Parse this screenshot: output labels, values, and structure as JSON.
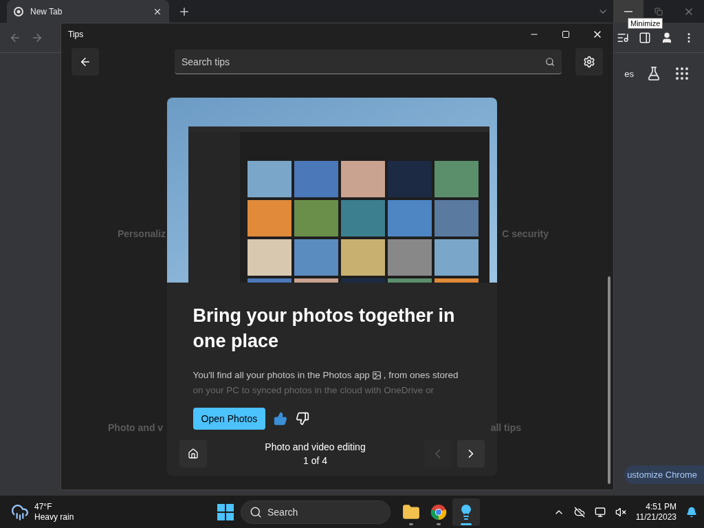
{
  "browser": {
    "tab": {
      "title": "New Tab",
      "selected": true
    },
    "tooltip": "Minimize",
    "toolbar_label": "es",
    "customize_button": "ustomize Chrome"
  },
  "tips": {
    "title": "Tips",
    "search": {
      "placeholder": "Search tips"
    },
    "background_tiles": [
      {
        "label": "Personaliz"
      },
      {
        "label": "C security"
      },
      {
        "label": "Photo and v"
      },
      {
        "label": "all tips"
      }
    ],
    "card": {
      "heading": "Bring your photos together in one place",
      "body_before_icon": "You'll find all your photos in the Photos app",
      "body_after_icon": ", from ones stored",
      "body_faded": "on your PC to synced photos in the cloud with OneDrive or",
      "action": "Open Photos",
      "liked": true,
      "disliked": false
    },
    "footer": {
      "category": "Photo and video editing",
      "position": "1 of 4",
      "prev_disabled": true,
      "next_disabled": false
    }
  },
  "taskbar": {
    "weather": {
      "temp": "47°F",
      "condition": "Heavy rain"
    },
    "search": {
      "placeholder": "Search"
    },
    "apps": [
      {
        "kind": "files",
        "active": false
      },
      {
        "kind": "chrome",
        "active": false
      },
      {
        "kind": "tips",
        "active": true
      }
    ],
    "clock": {
      "time": "4:51 PM",
      "date": "11/21/2023"
    }
  }
}
